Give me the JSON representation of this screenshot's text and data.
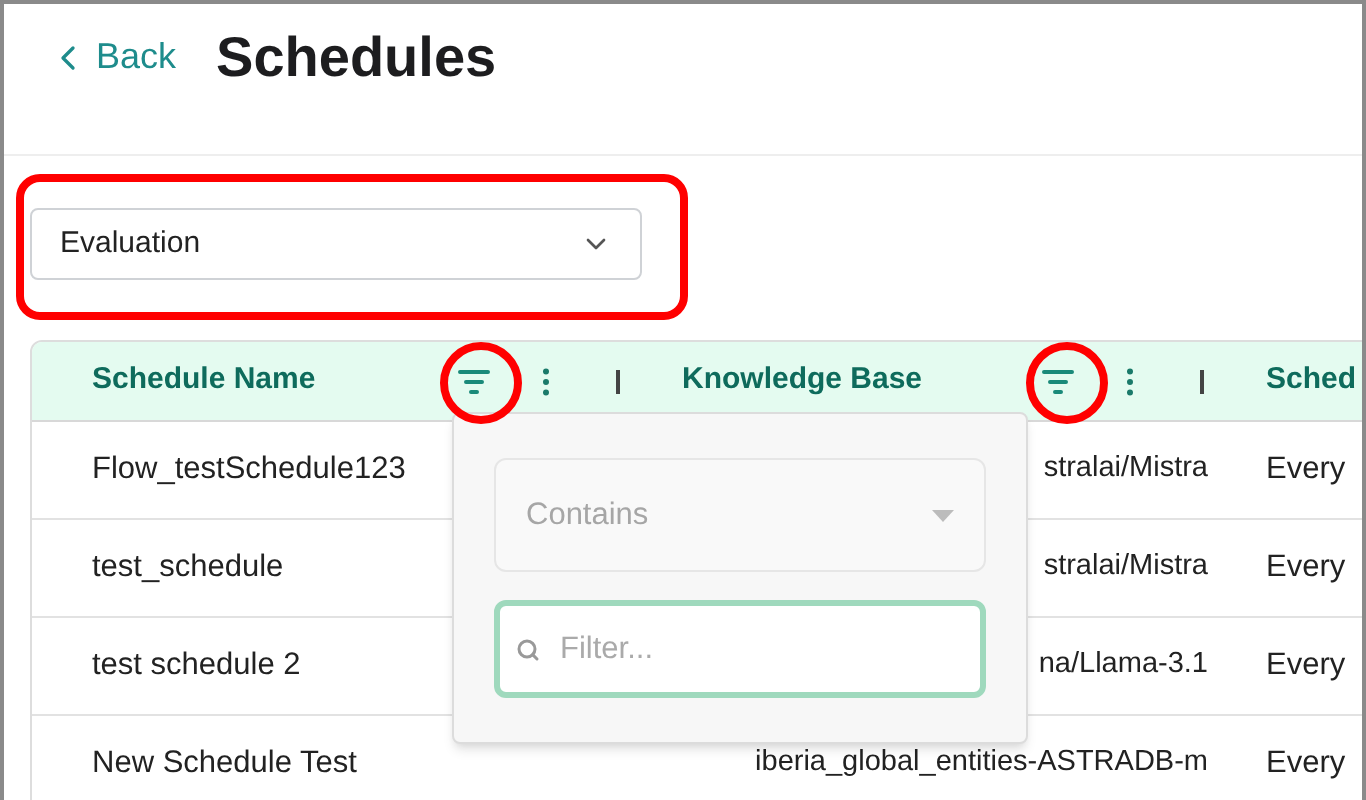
{
  "header": {
    "back": "Back",
    "title": "Schedules"
  },
  "type_select": {
    "value": "Evaluation"
  },
  "table": {
    "columns": [
      "Schedule Name",
      "Knowledge Base",
      "Sched"
    ],
    "rows": [
      [
        "Flow_testSchedule123",
        "stralai/Mistra",
        "Every"
      ],
      [
        "test_schedule",
        "stralai/Mistra",
        "Every"
      ],
      [
        "test schedule 2",
        "na/Llama-3.1",
        "Every"
      ],
      [
        "New Schedule Test",
        "iberia_global_entities-ASTRADB-m",
        "Every"
      ]
    ]
  },
  "filter_popup": {
    "operator": "Contains",
    "placeholder": "Filter..."
  }
}
